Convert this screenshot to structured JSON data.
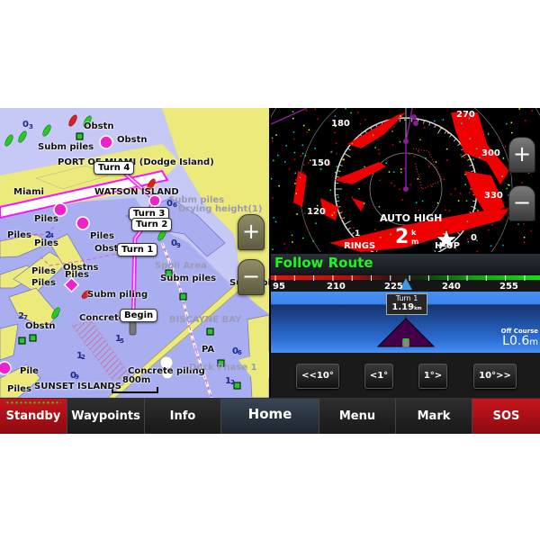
{
  "chart": {
    "labels": [
      {
        "text": "Obstn",
        "style": "bold"
      },
      {
        "text": "Subm piles",
        "style": "bold"
      },
      {
        "text": "Obstn",
        "style": "bold"
      },
      {
        "text": "PORT OF MIAMI (Dodge Island)",
        "style": "bold"
      },
      {
        "text": "Miami",
        "style": "bold"
      },
      {
        "text": "WATSON ISLAND",
        "style": "bold"
      },
      {
        "text": "Subm piles",
        "style": "faint"
      },
      {
        "text": "Drying height(1)",
        "style": "faint"
      },
      {
        "text": "Piles",
        "style": "bold"
      },
      {
        "text": "Piles",
        "style": "bold"
      },
      {
        "text": "Piles",
        "style": "bold"
      },
      {
        "text": "Piles",
        "style": "bold"
      },
      {
        "text": "Obstn",
        "style": "bold"
      },
      {
        "text": "Obstns",
        "style": "bold"
      },
      {
        "text": "Piles",
        "style": "bold"
      },
      {
        "text": "Piles",
        "style": "bold"
      },
      {
        "text": "Subm piling",
        "style": "bold"
      },
      {
        "text": "Piles",
        "style": "bold"
      },
      {
        "text": "Obstn",
        "style": "bold"
      },
      {
        "text": "Concrete",
        "style": "bold"
      },
      {
        "text": "Subm piles",
        "style": "bold"
      },
      {
        "text": "Subm pile",
        "style": "bold"
      },
      {
        "text": "Spoil Area",
        "style": "faint"
      },
      {
        "text": "BISCAYNE BAY",
        "style": "faint"
      },
      {
        "text": "PA",
        "style": "bold"
      },
      {
        "text": "Concrete piling",
        "style": "bold"
      },
      {
        "text": "Dock Phase 1",
        "style": "faint"
      },
      {
        "text": "Pile",
        "style": "bold"
      },
      {
        "text": "Piles",
        "style": "bold"
      },
      {
        "text": "SUNSET ISLANDS",
        "style": "bold"
      }
    ],
    "depths": [
      "0",
      "3",
      "2",
      "4",
      "2",
      "7",
      "0",
      "6",
      "0",
      "9",
      "1",
      "5",
      "1",
      "2",
      "0",
      "9",
      "0",
      "6",
      "1",
      "2"
    ],
    "route_waypoints": [
      "Turn 4",
      "Turn 3",
      "Turn 2",
      "Turn 1",
      "Begin"
    ],
    "scale_label": "800m",
    "zoom_in": "+",
    "zoom_out": "−",
    "colors": {
      "land": "#ecea7a",
      "shallow": "#a9aef0",
      "water": "#c6c8f5",
      "route": "#ff10ff"
    }
  },
  "radar": {
    "bearing_labels": [
      "180",
      "150",
      "120",
      "270",
      "300",
      "330",
      "0"
    ],
    "gain_mode": "AUTO HIGH",
    "rings_value": "1",
    "rings_unit": "km",
    "rings_label": "RINGS",
    "range_value": "2",
    "range_unit_top": "k",
    "range_unit_bottom": "m",
    "orientation": "H-UP",
    "zoom_in": "+",
    "zoom_out": "−"
  },
  "follow_route": {
    "title": "Follow Route",
    "heading_ticks": [
      "95",
      "210",
      "225",
      "240",
      "255"
    ],
    "waypoint_name": "Turn 1",
    "waypoint_distance": "1.19",
    "waypoint_distance_unit": "km",
    "off_course_label": "Off Course",
    "off_course_value": "L0.6",
    "off_course_unit": "m",
    "steer_buttons": [
      "<<10°",
      "<1°",
      "1°>",
      "10°>>"
    ]
  },
  "navbar": {
    "items": [
      {
        "label": "Standby",
        "color": "#c8141c"
      },
      {
        "label": "Waypoints"
      },
      {
        "label": "Info"
      },
      {
        "label": "Home"
      },
      {
        "label": "Menu"
      },
      {
        "label": "Mark"
      },
      {
        "label": "SOS",
        "color": "#c8141c"
      }
    ]
  }
}
